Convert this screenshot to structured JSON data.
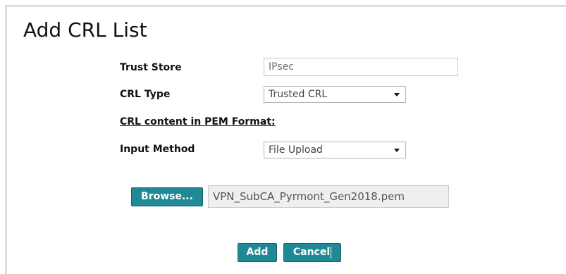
{
  "dialog": {
    "title": "Add CRL List"
  },
  "form": {
    "trust_store": {
      "label": "Trust Store",
      "value": "IPsec"
    },
    "crl_type": {
      "label": "CRL Type",
      "selected": "Trusted CRL"
    },
    "crl_content_heading": "CRL content in PEM Format:",
    "input_method": {
      "label": "Input Method",
      "selected": "File Upload"
    },
    "browse_label": "Browse...",
    "file_name": "VPN_SubCA_Pyrmont_Gen2018.pem"
  },
  "actions": {
    "add_label": "Add",
    "cancel_label": "Cancel"
  },
  "colors": {
    "button_bg": "#1f8a95",
    "button_text": "#ffffff"
  },
  "icons": {
    "dropdown_arrow": "chevron-down-icon"
  }
}
